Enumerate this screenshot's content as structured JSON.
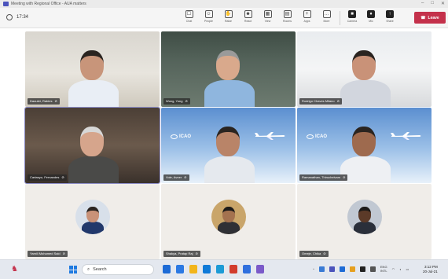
{
  "window": {
    "title": "Meeting with Regional Office - AUA matters"
  },
  "toolbar": {
    "timer": "17:34",
    "items": [
      {
        "label": "Chat",
        "icon": "chat-icon",
        "glyph": "☐"
      },
      {
        "label": "People",
        "icon": "people-icon",
        "glyph": "☺"
      },
      {
        "label": "Raise",
        "icon": "raise-hand-icon",
        "glyph": "✋"
      },
      {
        "label": "React",
        "icon": "react-icon",
        "glyph": "☻"
      },
      {
        "label": "View",
        "icon": "view-icon",
        "glyph": "▦"
      },
      {
        "label": "Rooms",
        "icon": "rooms-icon",
        "glyph": "▤"
      },
      {
        "label": "Apps",
        "icon": "apps-icon",
        "glyph": "+"
      },
      {
        "label": "More",
        "icon": "more-icon",
        "glyph": "…"
      }
    ],
    "devices": [
      {
        "label": "Camera",
        "icon": "camera-icon",
        "glyph": "■"
      },
      {
        "label": "Mic",
        "icon": "mic-icon",
        "glyph": "♦"
      },
      {
        "label": "Share",
        "icon": "share-icon",
        "glyph": "↑"
      }
    ],
    "leave_label": "Leave"
  },
  "participants": [
    {
      "name": "Daoulet, Rabies",
      "bg": "bg-room1",
      "skin": "#c8957a",
      "hair": "#2a2420",
      "shirt": "#e9eef5"
    },
    {
      "name": "Wong, Yong",
      "bg": "bg-room2",
      "skin": "#d9a98c",
      "hair": "#9a9a9a",
      "shirt": "#8fb6de"
    },
    {
      "name": "Rodrigo Chaves Milano",
      "bg": "bg-room3",
      "skin": "#c99278",
      "hair": "#2a2420",
      "shirt": "#d2d6de"
    },
    {
      "name": "Cartasyo, Fernandes",
      "bg": "bg-room4",
      "skin": "#d6a58c",
      "hair": "#d7d7d7",
      "shirt": "#4a4a48"
    },
    {
      "name": "Vole, Avner",
      "bg": "bg-icao",
      "skin": "#b98468",
      "hair": "#2a2420",
      "shirt": "#e5e9ee"
    },
    {
      "name": "Ramanathan, Thiruchelvam",
      "bg": "bg-icao",
      "skin": "#9e6a4e",
      "hair": "#2a2420",
      "shirt": "#eef0f3"
    },
    {
      "name": "Yamili Mohamed Said",
      "bg": "bg-plain",
      "avatar_bg": "#d8e0ea",
      "skin": "#c99278",
      "hair": "#2a2420",
      "shirt": "#21386b"
    },
    {
      "name": "Shakya, Pratap Raj",
      "bg": "bg-plain",
      "avatar_bg": "#c9a56a",
      "skin": "#a4724f",
      "hair": "#1c1a18",
      "shirt": "#2f3035"
    },
    {
      "name": "Omeje, Chika",
      "bg": "bg-plain",
      "avatar_bg": "#c1c8d2",
      "skin": "#5b3a28",
      "hair": "#1c1a18",
      "shirt": "#2a2f3a"
    }
  ],
  "icao_logo_text": "ICAO",
  "taskbar": {
    "search_placeholder": "Search",
    "apps": [
      "#1d6bd6",
      "#2b79e3",
      "#f2b51c",
      "#0f7ad8",
      "#1d9bd6",
      "#d23c2d",
      "#2f6fde",
      "#7b5ac9"
    ],
    "lang": "ENG",
    "region": "INTL",
    "time": "3:12 PM",
    "date": "20-Jul-21"
  },
  "colors": {
    "leave": "#c4314b",
    "accent": "#6264a7"
  }
}
